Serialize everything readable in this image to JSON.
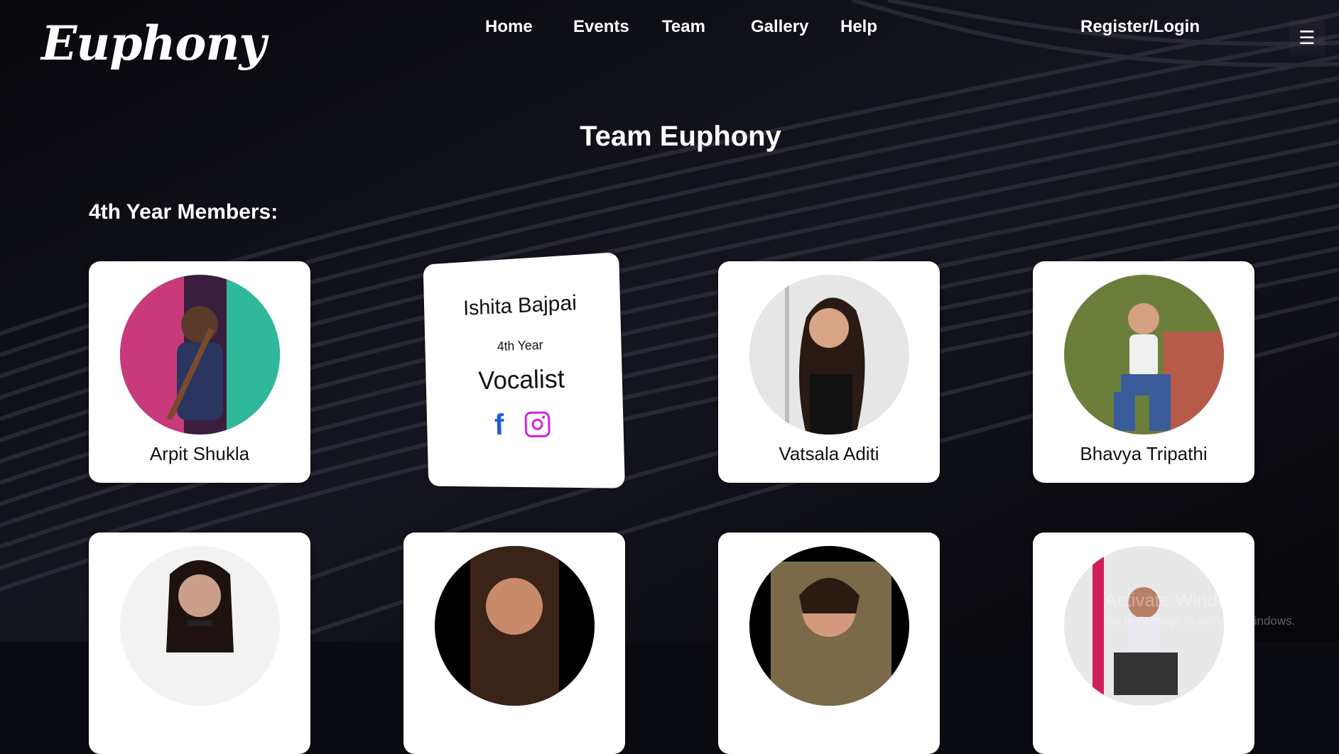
{
  "brand": {
    "logo_text": "Euphony"
  },
  "nav": {
    "home": "Home",
    "events": "Events",
    "team": "Team",
    "gallery": "Gallery",
    "help": "Help",
    "login": "Register/Login",
    "menu_icon": "☰"
  },
  "page": {
    "title": "Team Euphony",
    "section_title": "4th Year Members:"
  },
  "members_row1": [
    {
      "name": "Arpit Shukla"
    },
    {
      "name": "Ishita Bajpai",
      "year": "4th Year",
      "role": "Vocalist",
      "facebook_glyph": "f"
    },
    {
      "name": "Vatsala Aditi"
    },
    {
      "name": "Bhavya Tripathi"
    }
  ],
  "members_row2_icons": [
    "avatar",
    "avatar",
    "avatar",
    "avatar"
  ],
  "watermark": {
    "line1": "Activate Windows",
    "line2": "Go to Settings to activate Windows."
  },
  "colors": {
    "background": "#0b0b12",
    "card": "#ffffff",
    "facebook": "#1b5fd6",
    "instagram": "#d321d6"
  }
}
